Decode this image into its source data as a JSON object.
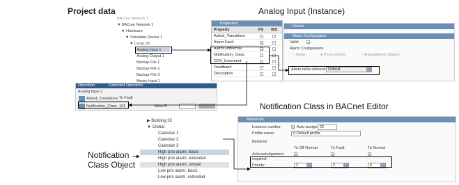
{
  "labels": {
    "project_data": "Project data",
    "analog_input": "Analog Input (Instance)",
    "notification_class_editor": "Notification Class in BACnet Editor",
    "nc_object_line1": "Notification",
    "nc_object_line2": "Class Object"
  },
  "project_tree": {
    "header": "BACnet Network 1",
    "items": [
      "Hardware",
      "Simulator Device 1",
      "Local_IO",
      "Analog Input 1",
      "Analog Output 1",
      "Backup File 1",
      "Backup File 2",
      "Backup File 3",
      "Binary Input 1"
    ]
  },
  "properties": {
    "title": "Properties",
    "col_property": "Property",
    "col_fs": "FS",
    "col_ws": "WS",
    "rows": [
      "Acked_Transitions",
      "Alarm Fault",
      "Alarm.Offnormal",
      "Notification_Class",
      "COV_Increment",
      "Deadband",
      "Description"
    ]
  },
  "details": {
    "details_title": "Details",
    "alarm_title": "Alarm Configuration",
    "valid_label": "Valid:",
    "alarm_cfg_label": "Alarm Configuration",
    "opt_none": "None",
    "opt_point": "Point system",
    "opt_mgmt": "Management Station",
    "ref_label": "Alarm table reference:",
    "ref_value": "Default"
  },
  "operation": {
    "tab1": "Operation",
    "tab2": "Extended Operation",
    "instance": "Analog Input 1",
    "to_fault": "To Fault",
    "row1": "Acked_Transitions",
    "row2": "Notification_Class",
    "row2_value": "101",
    "value_label": "Value B"
  },
  "nc_editor": {
    "title": "Advanced",
    "instance_label": "Instance number:",
    "auto_assign": "Auto-assign:",
    "instance_value": "22",
    "profile_label": "Profile name:",
    "profile_value": "0-Default profile",
    "behavior": "Behavior",
    "to_offnormal": "To Off Normal",
    "to_fault": "To Fault",
    "to_normal": "To Normal",
    "ack_label": "Acknowledgement required:",
    "priority_label": "Priority:",
    "priority_values": [
      "2",
      "2",
      "6"
    ]
  },
  "global_tree": {
    "items": [
      "Building 33",
      "Global",
      "Calendar 1",
      "Calendar 2",
      "Calendar 3",
      "High prio alarm, basic",
      "High prio alarm, extended",
      "High prio alarm, simple",
      "Low prio alarm, basic",
      "Low prio alarm, extended"
    ]
  }
}
